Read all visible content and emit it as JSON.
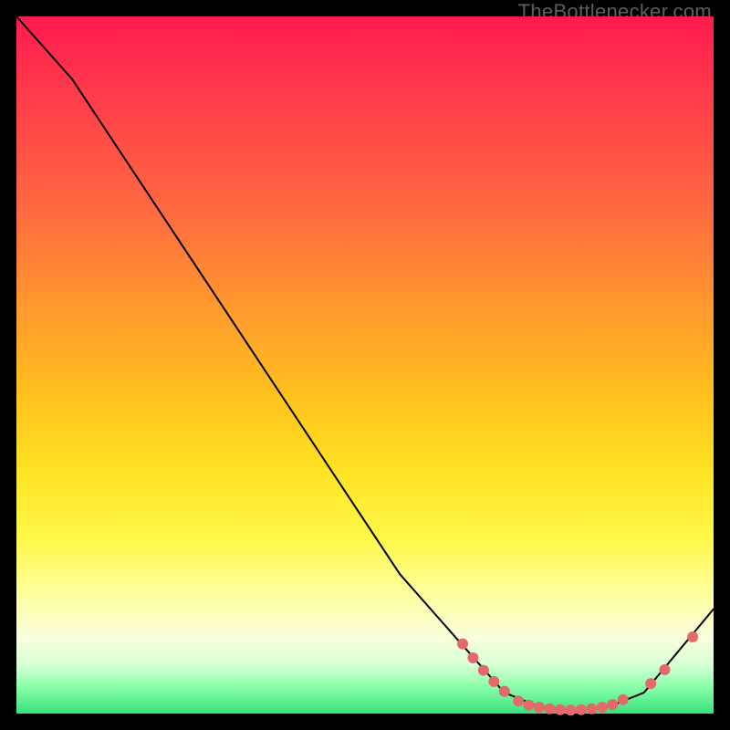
{
  "watermark": "TheBottlenecker.com",
  "chart_data": {
    "type": "line",
    "title": "",
    "xlabel": "",
    "ylabel": "",
    "xlim": [
      0,
      100
    ],
    "ylim": [
      0,
      100
    ],
    "axes_visible": false,
    "grid": false,
    "gradient": {
      "top": "#ff1a4e",
      "bottom": "#38e27c",
      "description": "red → orange → yellow → pale → green"
    },
    "series": [
      {
        "name": "curve",
        "color": "#000000",
        "stroke_width": 2,
        "x": [
          0,
          8,
          55,
          70,
          75,
          80,
          85,
          90,
          100
        ],
        "y": [
          100,
          91,
          20,
          3,
          1,
          0.5,
          1,
          3,
          15
        ]
      }
    ],
    "markers": [
      {
        "name": "dots",
        "color": "#e46a6a",
        "radius": 6,
        "points": [
          {
            "x": 64,
            "y": 10
          },
          {
            "x": 65.5,
            "y": 8
          },
          {
            "x": 67,
            "y": 6.2
          },
          {
            "x": 68.5,
            "y": 4.6
          },
          {
            "x": 70,
            "y": 3.2
          },
          {
            "x": 72,
            "y": 1.8
          },
          {
            "x": 73.5,
            "y": 1.2
          },
          {
            "x": 75,
            "y": 0.9
          },
          {
            "x": 76.5,
            "y": 0.7
          },
          {
            "x": 78,
            "y": 0.55
          },
          {
            "x": 79.5,
            "y": 0.5
          },
          {
            "x": 81,
            "y": 0.55
          },
          {
            "x": 82.5,
            "y": 0.7
          },
          {
            "x": 84,
            "y": 0.9
          },
          {
            "x": 85.5,
            "y": 1.3
          },
          {
            "x": 87,
            "y": 2
          },
          {
            "x": 91,
            "y": 4.3
          },
          {
            "x": 93,
            "y": 6.3
          },
          {
            "x": 97,
            "y": 11
          }
        ]
      }
    ]
  }
}
